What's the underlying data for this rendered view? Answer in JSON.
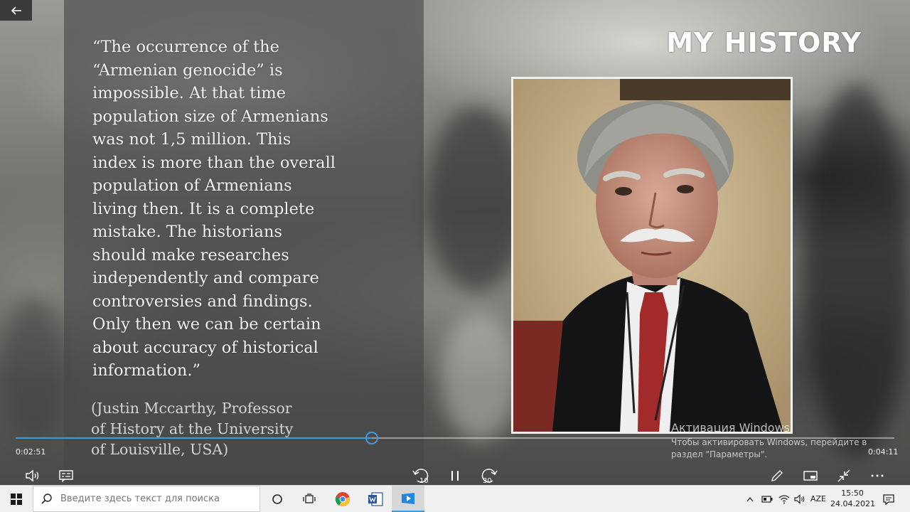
{
  "slide": {
    "title": "MY HISTORY",
    "quote": "“The occurrence of the\n“Armenian genocide” is\nimpossible. At that time\npopulation size of Armenians\nwas not 1,5 million. This\nindex is more than the overall\npopulation of Armenians\nliving then. It is a complete\nmistake. The historians\nshould make researches\nindependently and compare\ncontroversies and findings.\nOnly then we can be certain\nabout accuracy of historical\ninformation.”",
    "attribution": "(Justin Mccarthy, Professor\nof History at the University\nof Louisville, USA)"
  },
  "watermark": {
    "title": "Активация Windows",
    "subtitle": "Чтобы активировать Windows, перейдите в\nраздел \"Параметры\"."
  },
  "player": {
    "elapsed": "0:02:51",
    "duration": "0:04:11",
    "progress_fraction": 0.405,
    "skip_back_label": "10",
    "skip_forward_label": "30"
  },
  "taskbar": {
    "search_placeholder": "Введите здесь текст для поиска",
    "language": "AZE",
    "time": "15:50",
    "date": "24.04.2021"
  },
  "colors": {
    "accent": "#3e9de0",
    "quote_panel": "#464646",
    "taskbar": "#f0f0f0"
  }
}
